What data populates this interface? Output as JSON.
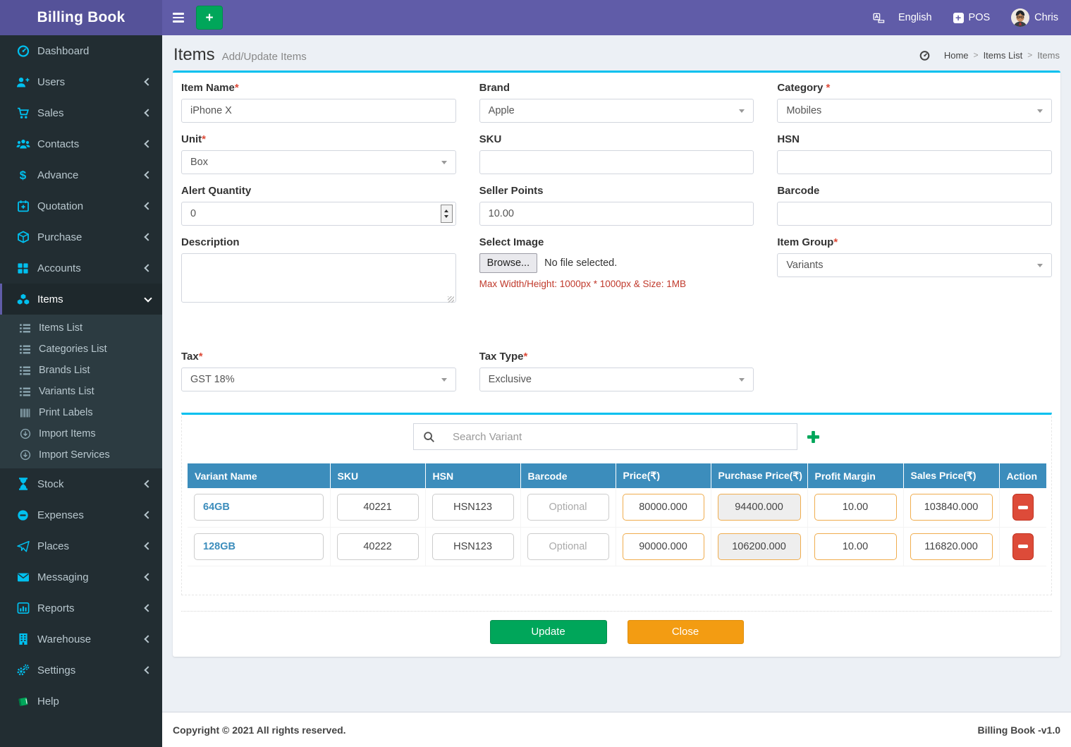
{
  "colors": {
    "navbar": "#605ca8",
    "logo_bg": "#555299",
    "sidebar_bg": "#222d32",
    "submenu_bg": "#2c3b41",
    "icon_cyan": "#00c0ef",
    "success_green": "#00a65a",
    "warning_orange": "#f39c12",
    "danger_red": "#dd4b39",
    "table_header_blue": "#3c8dbc",
    "price_border": "#f0ad4e",
    "box_top_border": "#00c0ef"
  },
  "header": {
    "brand": "Billing Book",
    "language": "English",
    "pos": "POS",
    "user": "Chris"
  },
  "sidebar": {
    "items": [
      {
        "label": "Dashboard",
        "icon": "gauge-icon"
      },
      {
        "label": "Users",
        "icon": "user-plus-icon"
      },
      {
        "label": "Sales",
        "icon": "cart-icon"
      },
      {
        "label": "Contacts",
        "icon": "users-icon"
      },
      {
        "label": "Advance",
        "icon": "dollar-icon"
      },
      {
        "label": "Quotation",
        "icon": "calendar-plus-icon"
      },
      {
        "label": "Purchase",
        "icon": "cube-icon"
      },
      {
        "label": "Accounts",
        "icon": "grid-icon"
      },
      {
        "label": "Items",
        "icon": "cubes-icon",
        "active": true,
        "expanded": true
      },
      {
        "label": "Stock",
        "icon": "hourglass-icon"
      },
      {
        "label": "Expenses",
        "icon": "minus-circle-icon"
      },
      {
        "label": "Places",
        "icon": "paper-plane-icon"
      },
      {
        "label": "Messaging",
        "icon": "envelope-icon"
      },
      {
        "label": "Reports",
        "icon": "bar-chart-icon"
      },
      {
        "label": "Warehouse",
        "icon": "building-icon"
      },
      {
        "label": "Settings",
        "icon": "gears-icon"
      },
      {
        "label": "Help",
        "icon": "book-icon"
      }
    ],
    "items_submenu": [
      "Items List",
      "Categories List",
      "Brands List",
      "Variants List",
      "Print Labels",
      "Import Items",
      "Import Services"
    ]
  },
  "page": {
    "title": "Items",
    "subtitle": "Add/Update Items",
    "breadcrumb": {
      "home": "Home",
      "parent": "Items List",
      "current": "Items",
      "separator": ">"
    }
  },
  "form": {
    "item_name": {
      "label": "Item Name",
      "required": "*",
      "value": "iPhone X"
    },
    "brand": {
      "label": "Brand",
      "value": "Apple"
    },
    "category": {
      "label": "Category",
      "required": " *",
      "value": "Mobiles"
    },
    "unit": {
      "label": "Unit",
      "required": "*",
      "value": "Box"
    },
    "sku": {
      "label": "SKU",
      "value": ""
    },
    "hsn": {
      "label": "HSN",
      "value": ""
    },
    "alert_quantity": {
      "label": "Alert Quantity",
      "value": "0"
    },
    "seller_points": {
      "label": "Seller Points",
      "value": "10.00"
    },
    "barcode": {
      "label": "Barcode",
      "value": ""
    },
    "description": {
      "label": "Description",
      "value": ""
    },
    "select_image": {
      "label": "Select Image",
      "browse": "Browse...",
      "no_file": "No file selected.",
      "hint": "Max Width/Height: 1000px * 1000px & Size: 1MB"
    },
    "item_group": {
      "label": "Item Group",
      "required": "*",
      "value": "Variants"
    },
    "tax": {
      "label": "Tax",
      "required": "*",
      "value": "GST 18%"
    },
    "tax_type": {
      "label": "Tax Type",
      "required": "*",
      "value": "Exclusive"
    }
  },
  "variants": {
    "search_placeholder": "Search Variant",
    "columns": [
      "Variant Name",
      "SKU",
      "HSN",
      "Barcode",
      "Price(₹)",
      "Purchase Price(₹)",
      "Profit Margin",
      "Sales Price(₹)",
      "Action"
    ],
    "rows": [
      {
        "name": "64GB",
        "sku": "40221",
        "hsn": "HSN123",
        "barcode_placeholder": "Optional",
        "price": "80000.000",
        "purchase_price": "94400.000",
        "profit_margin": "10.00",
        "sales_price": "103840.000"
      },
      {
        "name": "128GB",
        "sku": "40222",
        "hsn": "HSN123",
        "barcode_placeholder": "Optional",
        "price": "90000.000",
        "purchase_price": "106200.000",
        "profit_margin": "10.00",
        "sales_price": "116820.000"
      }
    ]
  },
  "actions": {
    "update": "Update",
    "close": "Close"
  },
  "footer": {
    "copyright": "Copyright © 2021 All rights reserved.",
    "version": "Billing Book -v1.0"
  }
}
